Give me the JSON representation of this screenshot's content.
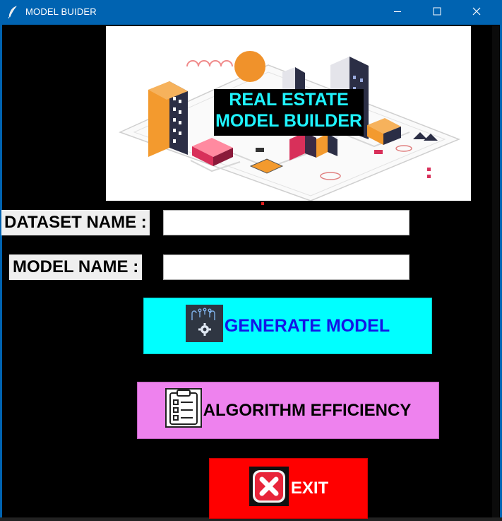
{
  "window": {
    "title": "MODEL BUIDER",
    "controls": {
      "minimize": "minimize-icon",
      "maximize": "maximize-icon",
      "close": "close-icon"
    }
  },
  "banner": {
    "title_line1": "REAL ESTATE",
    "title_line2": "MODEL BUILDER"
  },
  "form": {
    "dataset_label": "DATASET NAME :",
    "dataset_value": "",
    "model_label": "MODEL NAME :",
    "model_value": ""
  },
  "buttons": {
    "generate_label": "GENERATE MODEL",
    "generate_icon": "circuit-gear-icon",
    "algo_label": "ALGORITHM EFFICIENCY",
    "algo_icon": "clipboard-checklist-icon",
    "exit_label": "EXIT",
    "exit_icon": "close-x-icon"
  },
  "colors": {
    "titlebar": "#0063b1",
    "generate_bg": "#00ffff",
    "generate_text": "#1414e6",
    "algo_bg": "#ee82ee",
    "exit_bg": "#ff0000",
    "banner_title_text": "#1ff4ff"
  }
}
